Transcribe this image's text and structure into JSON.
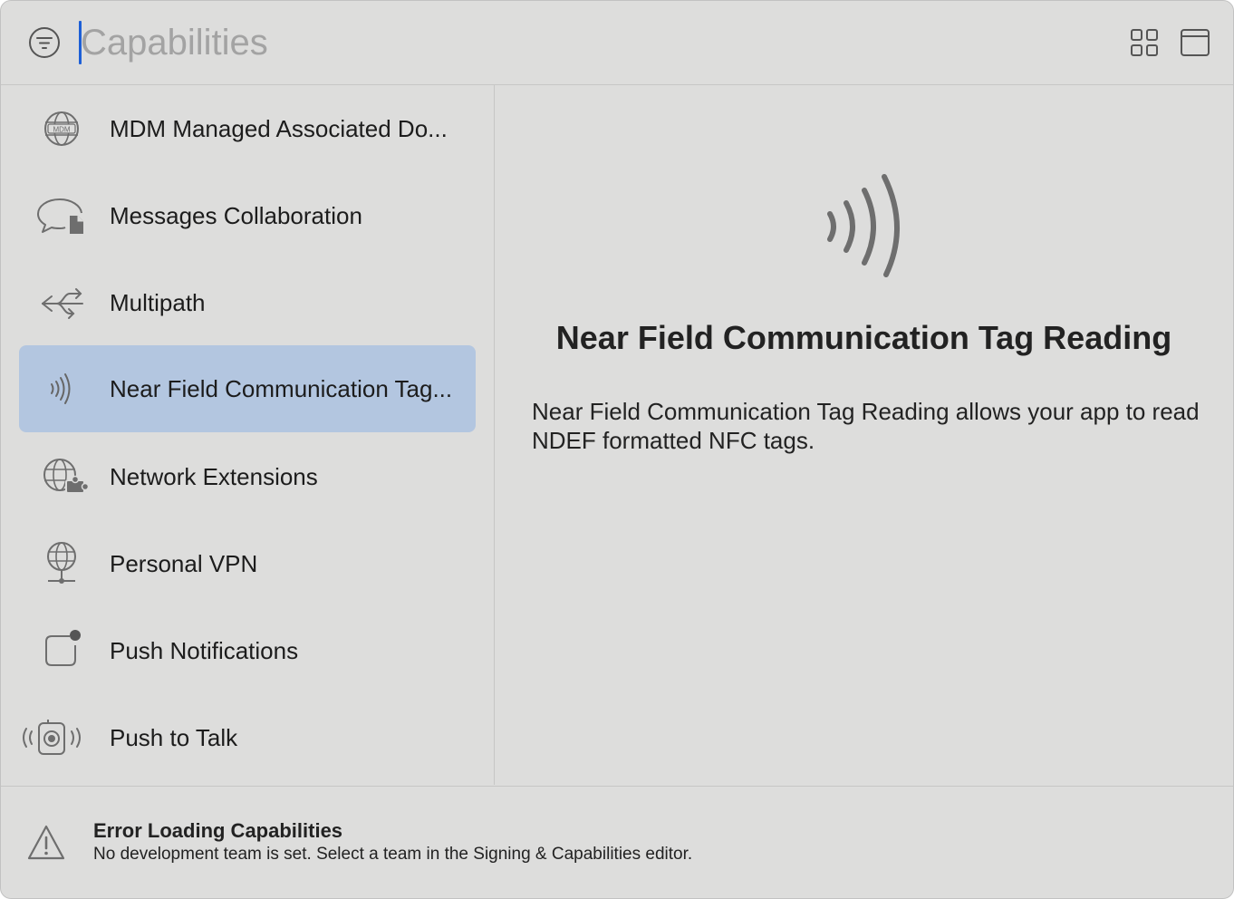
{
  "search": {
    "placeholder": "Capabilities",
    "value": ""
  },
  "toolbar": {
    "filter_icon": "filter-circle-icon",
    "grid_icon": "grid-view-icon",
    "window_icon": "window-layout-icon"
  },
  "sidebar": {
    "items": [
      {
        "label": "MDM Managed Associated Do...",
        "icon": "mdm-globe-icon",
        "selected": false
      },
      {
        "label": "Messages Collaboration",
        "icon": "chat-document-icon",
        "selected": false
      },
      {
        "label": "Multipath",
        "icon": "multipath-arrows-icon",
        "selected": false
      },
      {
        "label": "Near Field Communication Tag...",
        "icon": "nfc-waves-icon",
        "selected": true
      },
      {
        "label": "Network Extensions",
        "icon": "globe-puzzle-icon",
        "selected": false
      },
      {
        "label": "Personal VPN",
        "icon": "globe-network-icon",
        "selected": false
      },
      {
        "label": "Push Notifications",
        "icon": "notification-badge-icon",
        "selected": false
      },
      {
        "label": "Push to Talk",
        "icon": "walkie-talkie-icon",
        "selected": false
      }
    ]
  },
  "detail": {
    "icon": "nfc-waves-icon",
    "title": "Near Field Communication Tag Reading",
    "description": "Near Field Communication Tag Reading allows your app to read NDEF formatted NFC tags."
  },
  "footer": {
    "icon": "warning-triangle-icon",
    "title": "Error Loading Capabilities",
    "message": "No development team is set. Select a team in the Signing & Capabilities editor."
  },
  "colors": {
    "window_bg": "#dddddc",
    "selection_bg": "#b3c6e0",
    "caret": "#1d5fd6",
    "icon_gray": "#6e6e6e"
  }
}
